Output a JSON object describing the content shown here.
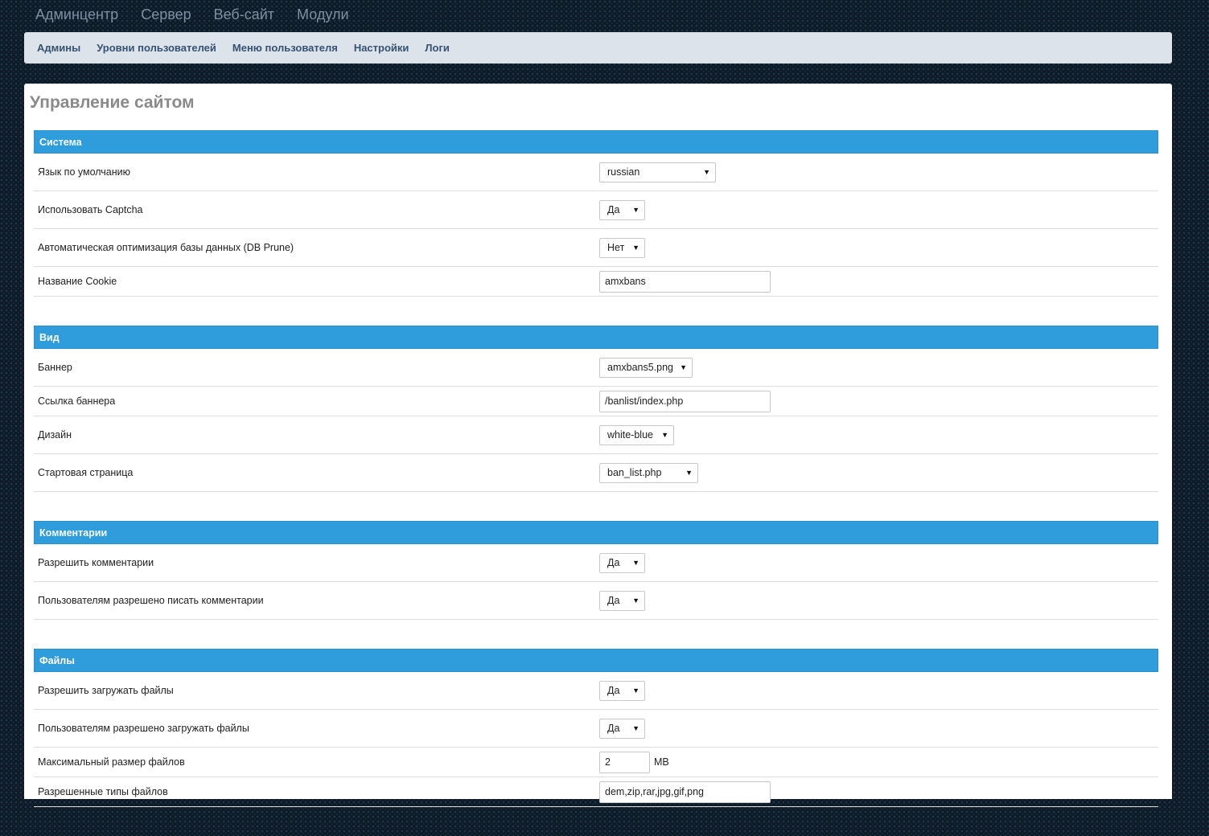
{
  "topnav": [
    "Админцентр",
    "Сервер",
    "Веб-сайт",
    "Модули"
  ],
  "subnav": [
    "Админы",
    "Уровни пользователей",
    "Меню пользователя",
    "Настройки",
    "Логи"
  ],
  "page_title": "Управление сайтом",
  "sections": {
    "system": {
      "title": "Система",
      "language": {
        "label": "Язык по умолчанию",
        "value": "russian"
      },
      "captcha": {
        "label": "Использовать Captcha",
        "value": "Да"
      },
      "db_prune": {
        "label": "Автоматическая оптимизация базы данных (DB Prune)",
        "value": "Нет"
      },
      "cookie": {
        "label": "Название Cookie",
        "value": "amxbans"
      }
    },
    "view": {
      "title": "Вид",
      "banner": {
        "label": "Баннер",
        "value": "amxbans5.png"
      },
      "banner_link": {
        "label": "Ссылка баннера",
        "value": "/banlist/index.php"
      },
      "design": {
        "label": "Дизайн",
        "value": "white-blue"
      },
      "start_page": {
        "label": "Стартовая страница",
        "value": "ban_list.php"
      }
    },
    "comments": {
      "title": "Комментарии",
      "allow": {
        "label": "Разрешить комментарии",
        "value": "Да"
      },
      "users_can": {
        "label": "Пользователям разрешено писать комментарии",
        "value": "Да"
      }
    },
    "files": {
      "title": "Файлы",
      "allow_upload": {
        "label": "Разрешить загружать файлы",
        "value": "Да"
      },
      "users_upload": {
        "label": "Пользователям разрешено загружать файлы",
        "value": "Да"
      },
      "max_size": {
        "label": "Максимальный размер файлов",
        "value": "2",
        "unit": "MB"
      },
      "types": {
        "label": "Разрешенные типы файлов",
        "value": "dem,zip,rar,jpg,gif,png"
      }
    }
  },
  "colors": {
    "accent": "#2f9cdb",
    "subnav_bg": "#dde3ea",
    "subnav_text": "#355272",
    "title": "#8a8a8a"
  },
  "icons": {
    "dropdown": "triangle-down"
  }
}
